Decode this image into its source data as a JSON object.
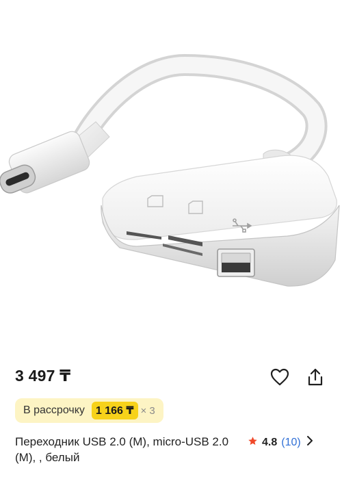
{
  "product": {
    "image_alt": "USB-C card reader adapter",
    "price": "3 497 ₸",
    "installment": {
      "label": "В рассрочку",
      "amount": "1 166 ₸",
      "multiplier": "× 3"
    },
    "title": "Переходник USB 2.0 (M), micro-USB 2.0 (M), , белый",
    "rating": {
      "value": "4.8",
      "reviews": "(10)"
    }
  },
  "icons": {
    "favorite": "heart-icon",
    "share": "share-icon",
    "rating": "star-icon",
    "more": "chevron-right-icon"
  },
  "colors": {
    "installment_bg": "#fdf4c4",
    "installment_amount_bg": "#f7d21a",
    "star": "#f0492a",
    "link": "#2f6fd6"
  }
}
